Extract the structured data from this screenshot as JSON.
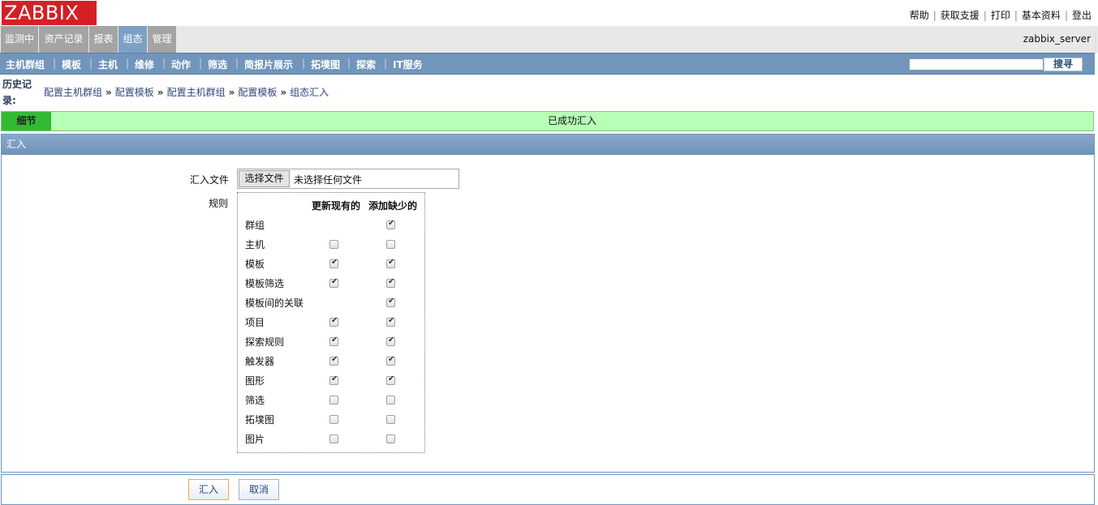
{
  "header": {
    "logo": "ZABBIX",
    "links": [
      "帮助",
      "获取支援",
      "打印",
      "基本资料",
      "登出"
    ]
  },
  "main_menu": {
    "items": [
      "监测中",
      "资产记录",
      "报表",
      "组态",
      "管理"
    ],
    "active": "组态",
    "server": "zabbix_server"
  },
  "sub_menu": {
    "items": [
      "主机群组",
      "模板",
      "主机",
      "维修",
      "动作",
      "筛选",
      "简报片展示",
      "拓墣图",
      "探索",
      "IT服务"
    ],
    "search_value": "",
    "search_button": "搜寻"
  },
  "breadcrumb": {
    "label": "历史记录:",
    "items": [
      "配置主机群组",
      "配置模板",
      "配置主机群组",
      "配置模板",
      "组态汇入"
    ]
  },
  "message": {
    "details": "细节",
    "text": "已成功汇入"
  },
  "panel": {
    "title": "汇入",
    "file_label": "汇入文件",
    "file_button": "选择文件",
    "file_status": "未选择任何文件",
    "rules_label": "规则",
    "col_update": "更新现有的",
    "col_add": "添加缺少的",
    "rules": [
      {
        "name": "群组",
        "update": null,
        "add": true
      },
      {
        "name": "主机",
        "update": false,
        "add": false
      },
      {
        "name": "模板",
        "update": true,
        "add": true
      },
      {
        "name": "模板筛选",
        "update": true,
        "add": true
      },
      {
        "name": "模板间的关联",
        "update": null,
        "add": true
      },
      {
        "name": "项目",
        "update": true,
        "add": true
      },
      {
        "name": "探索规则",
        "update": true,
        "add": true
      },
      {
        "name": "触发器",
        "update": true,
        "add": true
      },
      {
        "name": "图形",
        "update": true,
        "add": true
      },
      {
        "name": "筛选",
        "update": false,
        "add": false
      },
      {
        "name": "拓墣图",
        "update": false,
        "add": false
      },
      {
        "name": "图片",
        "update": false,
        "add": false
      }
    ]
  },
  "footer": {
    "import_button": "汇入",
    "cancel_button": "取消"
  }
}
